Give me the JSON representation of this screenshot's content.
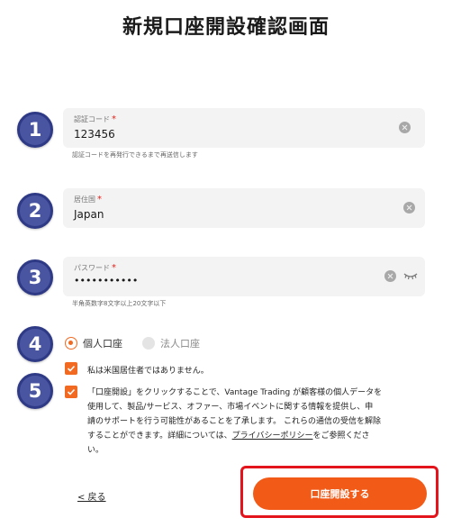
{
  "page": {
    "title": "新規口座開設確認画面"
  },
  "steps": [
    "1",
    "2",
    "3",
    "4",
    "5"
  ],
  "verification_code": {
    "label": "認証コード",
    "required_mark": "*",
    "value": "123456",
    "hint": "認証コードを再発行できるまで再送信します",
    "clear_icon": "clear-icon"
  },
  "country": {
    "label": "居住国",
    "required_mark": "*",
    "value": "Japan",
    "clear_icon": "clear-icon"
  },
  "password": {
    "label": "パスワード",
    "required_mark": "*",
    "value": "•••••••••••",
    "hint": "半角英数字8文字以上20文字以下",
    "clear_icon": "clear-icon",
    "visibility_icon": "eye-closed-icon"
  },
  "account_type": {
    "options": [
      {
        "label": "個人口座",
        "selected": true
      },
      {
        "label": "法人口座",
        "selected": false
      }
    ]
  },
  "us_resident": {
    "checked": true,
    "label": "私は米国居住者ではありません。"
  },
  "consent": {
    "checked": true,
    "line1": "「口座開設」をクリックすることで、Vantage Trading が顧客様の個人データを",
    "line2": "使用して、製品/サービス、オファー、市場イベントに関する情報を提供し、申",
    "line3": "請のサポートを行う可能性があることを了承します。 これらの通信の受信を解除",
    "line4_before": "することができます。詳細については、",
    "line4_link": "プライバシーポリシー",
    "line4_after": "をご参照くださ",
    "line5": "い。"
  },
  "actions": {
    "back_label": "< 戻る",
    "submit_label": "口座開設する"
  },
  "colors": {
    "accent": "#f25a18",
    "step_badge": "#4a55a2",
    "highlight_border": "#e3141b",
    "required": "#e0241d"
  }
}
